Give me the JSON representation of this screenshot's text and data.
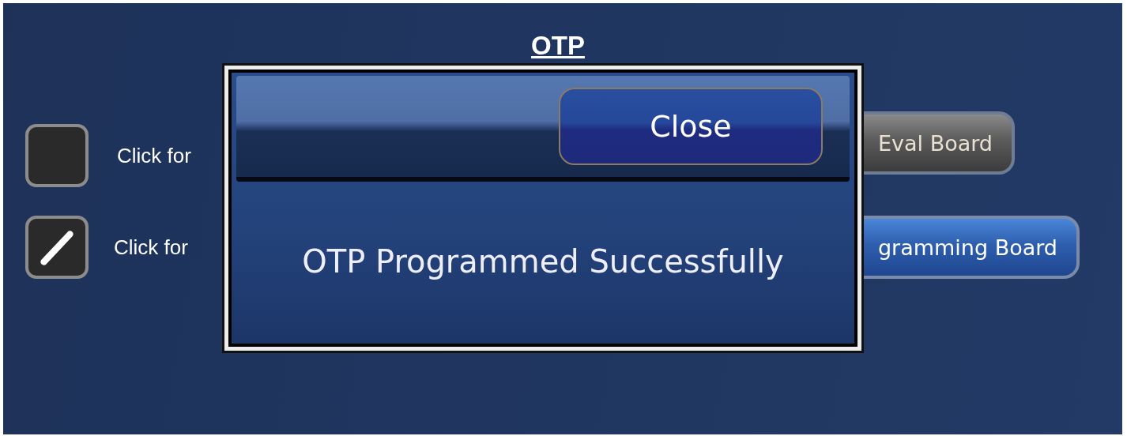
{
  "title": "OTP",
  "options": [
    {
      "label": "Click for",
      "checked": false,
      "button": {
        "label": "Eval Board",
        "kind": "gray"
      }
    },
    {
      "label": "Click for",
      "checked": true,
      "button": {
        "label": "gramming Board",
        "kind": "blue"
      }
    }
  ],
  "dialog": {
    "button": "Close",
    "message": "OTP Programmed Successfully"
  }
}
